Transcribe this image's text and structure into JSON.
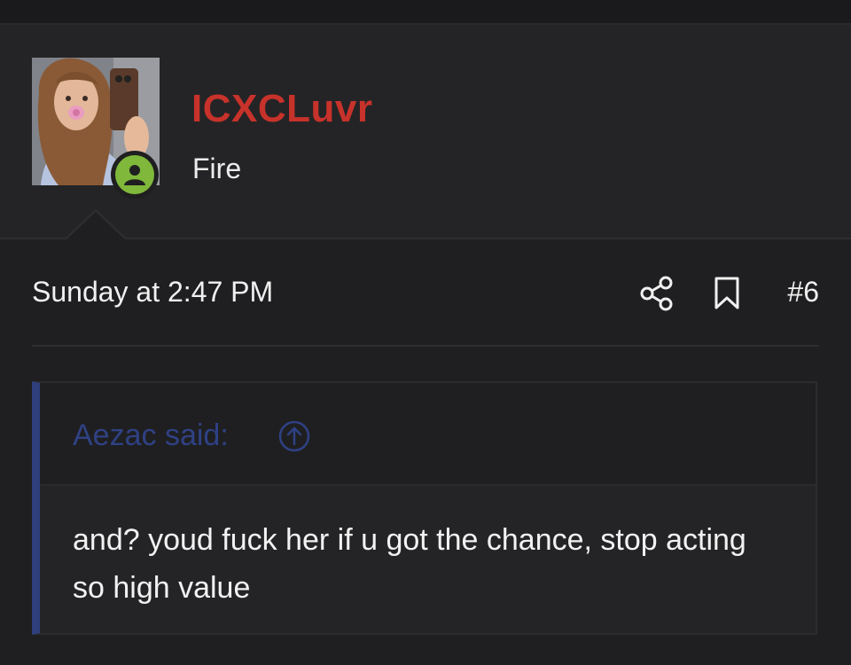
{
  "user": {
    "username": "ICXCLuvr",
    "title": "Fire",
    "online_status": "online",
    "username_color": "#c7322a"
  },
  "post": {
    "date": "Sunday at 2:47 PM",
    "number": "#6",
    "actions": [
      {
        "icon": "share-icon"
      },
      {
        "icon": "bookmark-icon"
      }
    ]
  },
  "quote": {
    "author_label": "Aezac said:",
    "jump_icon": "arrow-up-circle-icon",
    "text": "and? youd fuck her if u got the chance, stop acting so high value",
    "accent_color": "#2f3f7d"
  },
  "colors": {
    "background": "#1f1f21",
    "online_badge": "#7fb83a"
  }
}
